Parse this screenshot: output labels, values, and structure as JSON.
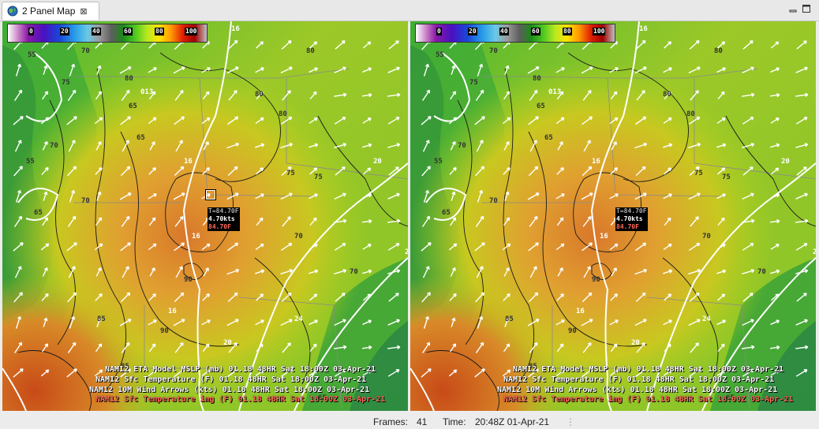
{
  "window": {
    "tab_title": "2 Panel Map",
    "colors": {
      "panel_background": "#7fbf2a",
      "tab_background": "#ffffff",
      "chrome": "#e8e8e8"
    }
  },
  "colorbar": {
    "ticks": [
      "0",
      "20",
      "40",
      "60",
      "80",
      "100"
    ]
  },
  "panels": [
    {
      "legend": [
        "NAM12 ETA Model MSLP (mb)  01.18  48HR Sat 18:00Z 03-Apr-21",
        "NAM12 Sfc Temperature (F)  01.18  48HR Sat 18:00Z 03-Apr-21",
        "NAM12 10M Wind Arrows (kts)  01.18  48HR Sat 18:00Z 03-Apr-21",
        "NAM12 Sfc Temperature img (F)  01.18  48HR Sat 18:00Z 03-Apr-21"
      ],
      "readout": [
        "T=84.70F",
        "4.70kts",
        "84.70F"
      ]
    },
    {
      "legend": [
        "NAM12 ETA Model MSLP (mb)  01.18  48HR Sat 18:00Z 03-Apr-21",
        "NAM12 Sfc Temperature (F)  01.18  48HR Sat 18:00Z 03-Apr-21",
        "NAM12 10M Wind Arrows (kts)  01.18  48HR Sat 18:00Z 03-Apr-21",
        "NAM12 Sfc Temperature img (F)  01.18  48HR Sat 18:00Z 03-Apr-21"
      ],
      "readout": [
        "T=84.70F",
        "4.70kts",
        "84.70F"
      ]
    }
  ],
  "map_labels": [
    "55",
    "65",
    "70",
    "75",
    "80",
    "85",
    "90",
    "16",
    "20",
    "24",
    "013"
  ],
  "status": {
    "frames_label": "Frames:",
    "frames_value": "41",
    "time_label": "Time:",
    "time_value": "20:48Z 01-Apr-21"
  }
}
